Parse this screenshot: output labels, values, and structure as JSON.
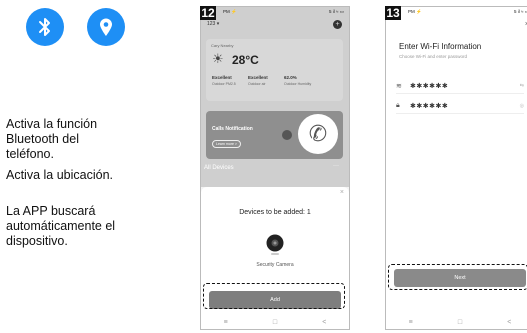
{
  "left": {
    "icons": [
      "bluetooth-icon",
      "location-icon"
    ],
    "icon_color": "#1e8ff5",
    "instructions": [
      "Activa la función\nBluetooth del\nteléfono.",
      " Activa la ubicación.",
      "La APP buscará\nautomáticamente el\ndispositivo."
    ]
  },
  "step12": {
    "badge": "12",
    "status_left": "PM ⚡",
    "status_right": "5 il ≈ ▭",
    "home_label": "123 ▾",
    "weather": {
      "location": "Cary Nearby",
      "temperature": "28°C",
      "air_quality": "Excellent",
      "air_label": "Outdoor PM2.5",
      "comfort": "Excellent",
      "comfort_label": "Outdoor air",
      "humidity": "62.0%",
      "humidity_label": "Outdoor Humidity"
    },
    "notification": {
      "title": "Calls Notification",
      "button": "Learn more >"
    },
    "all_devices": "All Devices",
    "more": "···",
    "sheet": {
      "close": "×",
      "title": "Devices to be added: 1",
      "device_name": "Security Camera",
      "add_button": "Add"
    },
    "nav": [
      "≡",
      "□",
      "<"
    ]
  },
  "step13": {
    "badge": "13",
    "status_left": "PM ⚡",
    "status_right": "5 il ≈ ▭",
    "close": "×",
    "title": "Enter Wi-Fi Information",
    "subtitle": "Choose Wi-Fi and enter password",
    "ssid": "✱✱✱✱✱✱",
    "password": "✱✱✱✱✱✱",
    "next_button": "Next",
    "nav": [
      "≡",
      "□",
      "<"
    ]
  }
}
